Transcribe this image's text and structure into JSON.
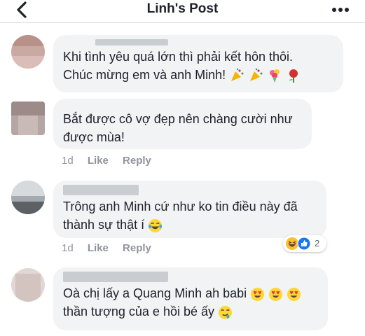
{
  "header": {
    "title": "Linh's Post"
  },
  "comments": [
    {
      "lines": [
        "Khi tình yêu quá lớn thì phải kết hôn thôi.",
        "Chúc mừng em và anh Minh!"
      ],
      "emojis": [
        "party-popper",
        "party-popper",
        "bouquet",
        "rose"
      ]
    },
    {
      "lines": [
        "Bắt được cô vợ đẹp nên chàng cười như",
        "được mùa!"
      ],
      "time": "1d",
      "like": "Like",
      "reply": "Reply"
    },
    {
      "lines": [
        "Trông anh Minh cứ như ko tin điều này đã",
        "thành sự thật í"
      ],
      "emojis": [
        "tears-of-joy"
      ],
      "time": "1d",
      "like": "Like",
      "reply": "Reply",
      "reactions": {
        "count": "2",
        "icons": [
          "laughing",
          "like"
        ]
      }
    },
    {
      "lines": [
        "Oà chị lấy a Quang Minh ah babi",
        "thần tượng của e hồi bé ấy"
      ],
      "emojis_line1": [
        "heart-eyes",
        "heart-eyes",
        "heart-eyes"
      ],
      "emojis_line2": [
        "drooling"
      ]
    }
  ],
  "colors": {
    "bubble": "#f2f3f5",
    "meta": "#90949c",
    "like_blue": "#1877f2"
  }
}
